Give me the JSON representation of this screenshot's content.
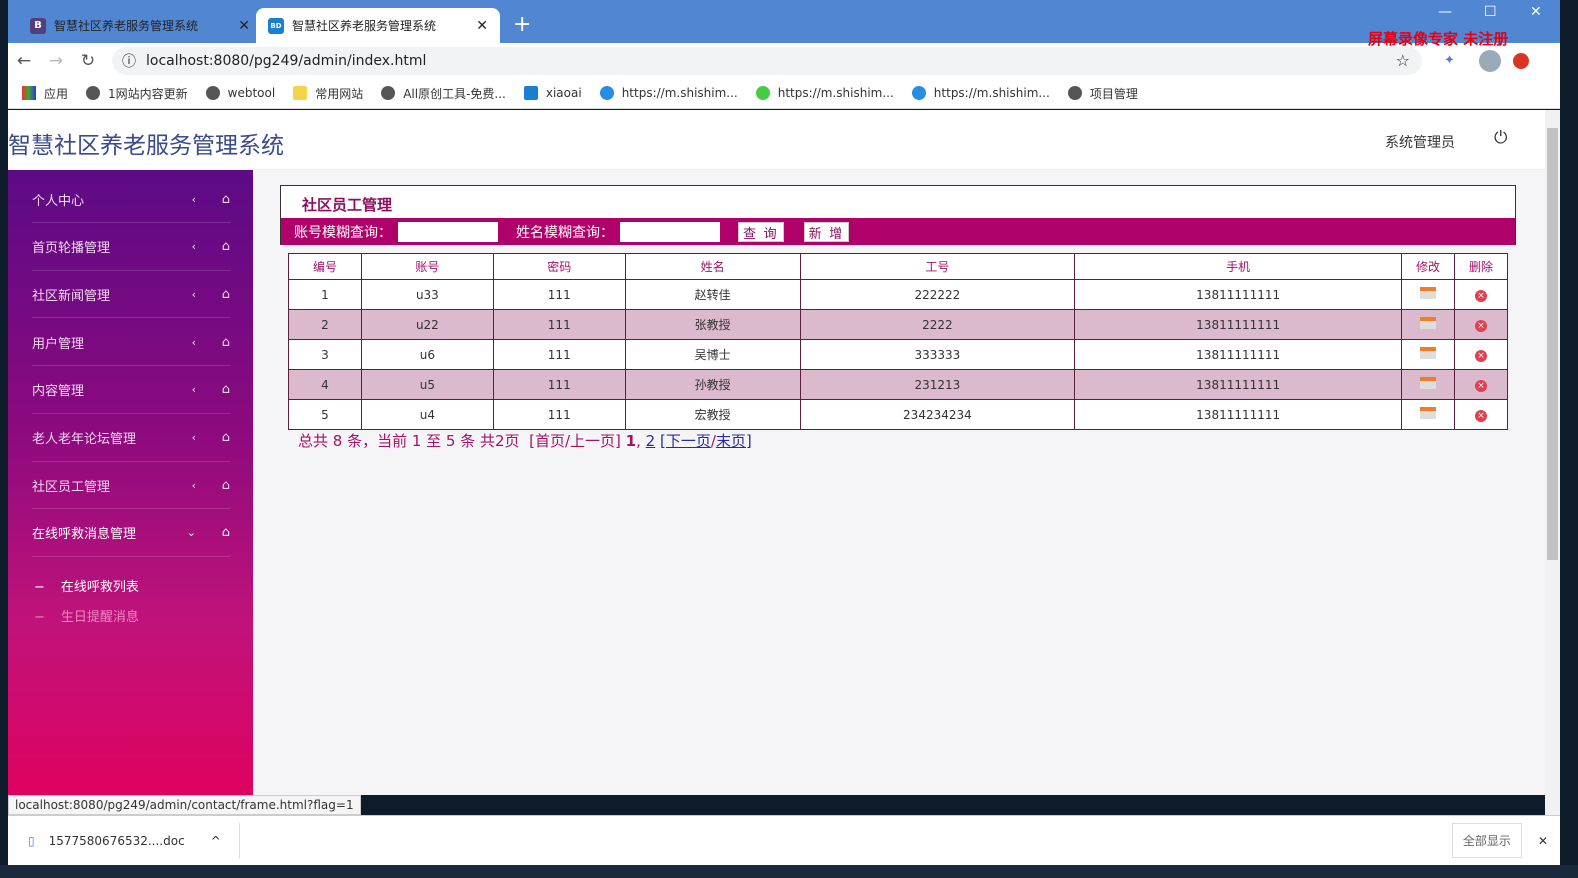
{
  "browser": {
    "tabs": [
      {
        "label": "智慧社区养老服务管理系统",
        "favicon": "B",
        "active": false
      },
      {
        "label": "智慧社区养老服务管理系统",
        "favicon": "BD",
        "active": true
      }
    ],
    "url": "localhost:8080/pg249/admin/index.html",
    "bookmarks": [
      "应用",
      "1网站内容更新",
      "webtool",
      "常用网站",
      "All原创工具-免费...",
      "xiaoai",
      "https://m.shishim...",
      "https://m.shishim...",
      "https://m.shishim...",
      "项目管理"
    ],
    "watermark": "屏幕录像专家  未注册",
    "status_url": "localhost:8080/pg249/admin/contact/frame.html?flag=1",
    "download": {
      "file": "1577580676532....doc",
      "show_all": "全部显示"
    }
  },
  "header": {
    "title": "智慧社区养老服务管理系统",
    "user": "系统管理员"
  },
  "sidebar": {
    "items": [
      "个人中心",
      "首页轮播管理",
      "社区新闻管理",
      "用户管理",
      "内容管理",
      "老人老年论坛管理",
      "社区员工管理",
      "在线呼救消息管理"
    ],
    "expanded": "在线呼救消息管理",
    "subitems": [
      "在线呼救列表",
      "生日提醒消息"
    ]
  },
  "panel": {
    "title": "社区员工管理",
    "search_account_label": "账号模糊查询：",
    "search_name_label": "姓名模糊查询：",
    "search_button": "查 询",
    "add_button": "新 增"
  },
  "table": {
    "headers": [
      "编号",
      "账号",
      "密码",
      "姓名",
      "工号",
      "手机",
      "修改",
      "删除"
    ],
    "rows": [
      [
        "1",
        "u33",
        "111",
        "赵转佳",
        "222222",
        "13811111111"
      ],
      [
        "2",
        "u22",
        "111",
        "张教授",
        "2222",
        "13811111111"
      ],
      [
        "3",
        "u6",
        "111",
        "吴博士",
        "333333",
        "13811111111"
      ],
      [
        "4",
        "u5",
        "111",
        "孙教授",
        "231213",
        "13811111111"
      ],
      [
        "5",
        "u4",
        "111",
        "宏教授",
        "234234234",
        "13811111111"
      ]
    ]
  },
  "pager": {
    "summary": "总共 8 条，当前 1 至 5 条 共2页",
    "first_prev": "[首页/上一页]",
    "page1": "1",
    "page2": "2",
    "next": "[下一页",
    "last": "末页]"
  },
  "colors": {
    "accent": "#b0006a",
    "sidebar_top": "#5c0a86",
    "sidebar_bottom": "#e2005c",
    "row_alt": "#dbbace"
  }
}
